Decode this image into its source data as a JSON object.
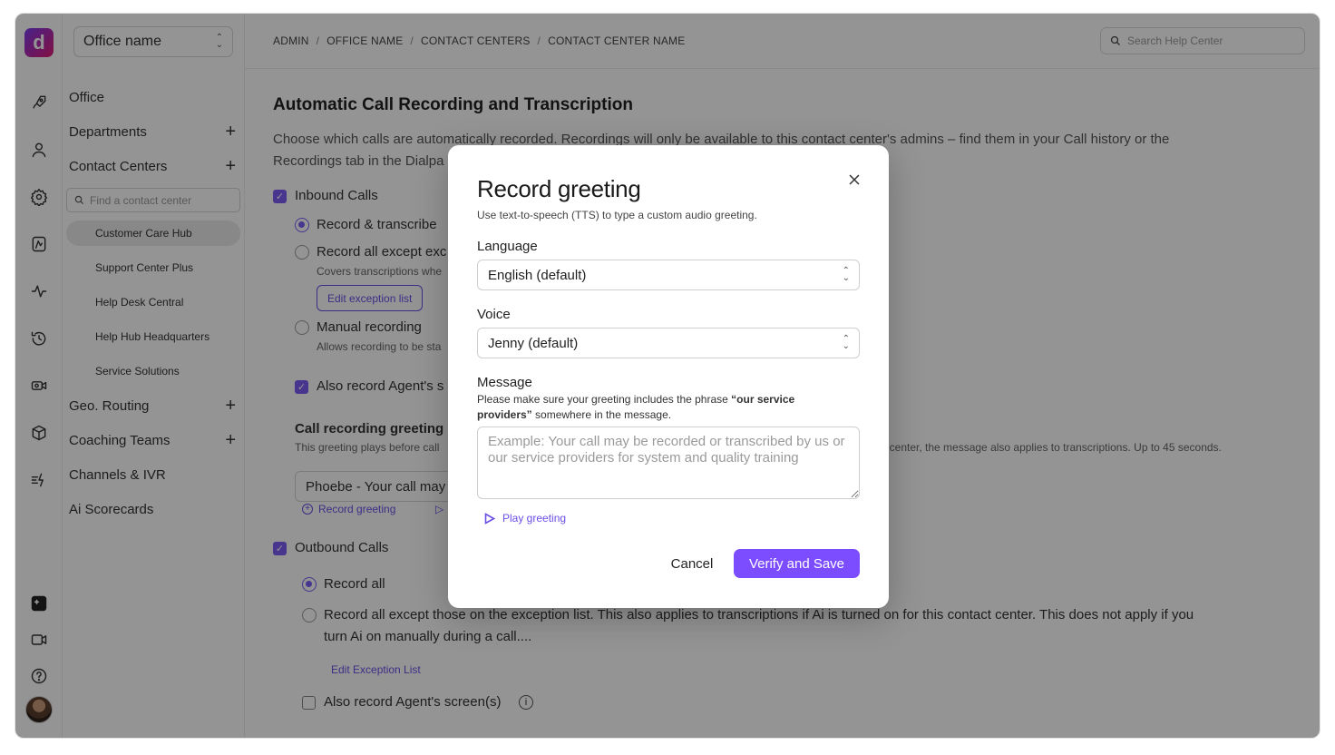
{
  "app": {
    "office_select": "Office name",
    "logo": "d"
  },
  "sidebar": {
    "items": [
      {
        "label": "Office",
        "has_add": false
      },
      {
        "label": "Departments",
        "has_add": true
      },
      {
        "label": "Contact Centers",
        "has_add": true
      }
    ],
    "find_placeholder": "Find a contact center",
    "contact_centers": [
      {
        "label": "Customer Care Hub",
        "active": true
      },
      {
        "label": "Support Center Plus",
        "active": false
      },
      {
        "label": "Help Desk Central",
        "active": false
      },
      {
        "label": "Help Hub Headquarters",
        "active": false
      },
      {
        "label": "Service Solutions",
        "active": false
      }
    ],
    "more_items": [
      {
        "label": "Geo. Routing",
        "has_add": true
      },
      {
        "label": "Coaching Teams",
        "has_add": true
      },
      {
        "label": "Channels & IVR",
        "has_add": false
      },
      {
        "label": "Ai Scorecards",
        "has_add": false
      }
    ]
  },
  "header": {
    "breadcrumbs": [
      "ADMIN",
      "OFFICE NAME",
      "CONTACT CENTERS",
      "CONTACT CENTER NAME"
    ],
    "search_placeholder": "Search Help Center"
  },
  "main": {
    "title": "Automatic Call Recording and Transcription",
    "description_line1": "Choose which calls are automatically recorded. Recordings will only be available to this contact center's admins – find them in your Call history or the",
    "description_line2": "Recordings tab in the Dialpa",
    "inbound": {
      "label": "Inbound Calls",
      "option1": "Record & transcribe",
      "option2": "Record all except exc",
      "option2_note": "Covers transcriptions whe",
      "edit_exception": "Edit exception list",
      "option3": "Manual recording",
      "option3_note": "Allows recording to be sta",
      "also_record": "Also record Agent's s"
    },
    "greeting": {
      "title": "Call recording greeting",
      "desc_left": "This greeting plays before call",
      "desc_right": "t center, the message also applies to transcriptions. Up to 45 seconds.",
      "value": "Phoebe - Your call may",
      "record_link": "Record greeting"
    },
    "outbound": {
      "label": "Outbound Calls",
      "option1": "Record all",
      "option2_line1": "Record all except those on the exception list. This also applies to transcriptions if Ai is turned on for this contact center. This does not apply if you",
      "option2_line2": "turn Ai on manually during a call....",
      "edit_exception": "Edit Exception List",
      "also_record": "Also record Agent's screen(s)"
    }
  },
  "modal": {
    "title": "Record greeting",
    "subtitle": "Use text-to-speech (TTS) to type a custom audio greeting.",
    "language_label": "Language",
    "language_value": "English (default)",
    "voice_label": "Voice",
    "voice_value": "Jenny (default)",
    "message_label": "Message",
    "helper_prefix": "Please make sure your greeting includes the phrase ",
    "helper_phrase": "“our service providers”",
    "helper_suffix": " somewhere in the message.",
    "message_placeholder": "Example: Your call may be recorded or transcribed by us or our service providers for system and quality training",
    "play_label": "Play greeting",
    "cancel_label": "Cancel",
    "save_label": "Verify and Save"
  },
  "colors": {
    "accent": "#7c4dff",
    "link": "#6b4ee6"
  }
}
